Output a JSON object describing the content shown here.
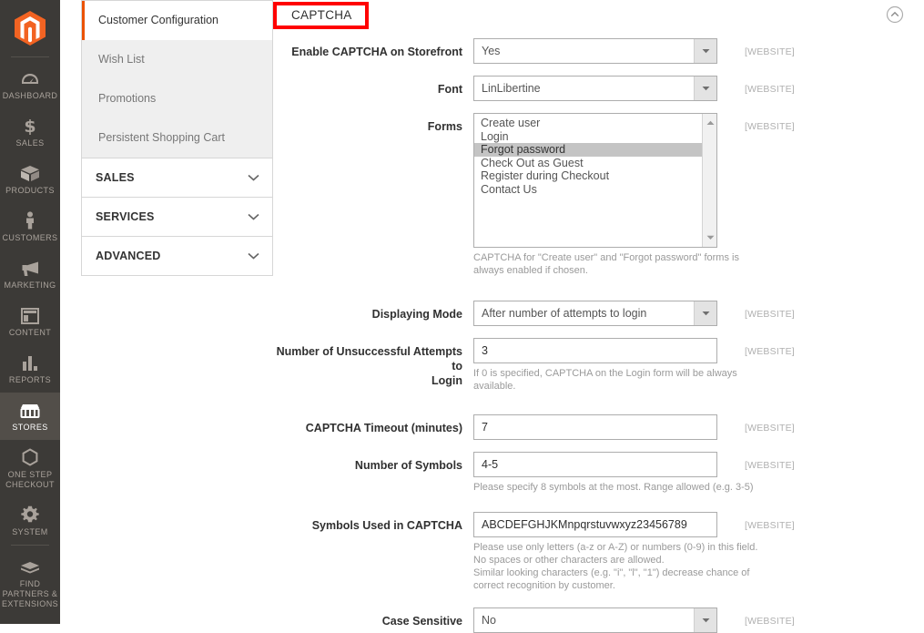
{
  "admin_rail": {
    "logo_name": "magento-logo",
    "items": [
      {
        "label": "DASHBOARD",
        "icon": "dashboard-icon",
        "active": false
      },
      {
        "label": "SALES",
        "icon": "dollar-icon",
        "active": false
      },
      {
        "label": "PRODUCTS",
        "icon": "box-icon",
        "active": false
      },
      {
        "label": "CUSTOMERS",
        "icon": "person-icon",
        "active": false
      },
      {
        "label": "MARKETING",
        "icon": "megaphone-icon",
        "active": false
      },
      {
        "label": "CONTENT",
        "icon": "layout-icon",
        "active": false
      },
      {
        "label": "REPORTS",
        "icon": "bar-chart-icon",
        "active": false
      },
      {
        "label": "STORES",
        "icon": "storefront-icon",
        "active": true
      },
      {
        "label": "ONE STEP CHECKOUT",
        "icon": "hexagon-icon",
        "active": false
      },
      {
        "label": "SYSTEM",
        "icon": "gear-icon",
        "active": false
      },
      {
        "label": "FIND PARTNERS & EXTENSIONS",
        "icon": "partners-icon",
        "active": false
      }
    ]
  },
  "config_nav": {
    "links": [
      {
        "label": "Customer Configuration",
        "active": true
      },
      {
        "label": "Wish List",
        "active": false
      },
      {
        "label": "Promotions",
        "active": false
      },
      {
        "label": "Persistent Shopping Cart",
        "active": false
      }
    ],
    "sections": [
      {
        "label": "SALES"
      },
      {
        "label": "SERVICES"
      },
      {
        "label": "ADVANCED"
      }
    ]
  },
  "section": {
    "title": "CAPTCHA",
    "collapse_icon": "chevron-up-circle-icon",
    "highlight_color": "#ff0000"
  },
  "scope_label": "[WEBSITE]",
  "fields": {
    "enable": {
      "label": "Enable CAPTCHA on Storefront",
      "value": "Yes",
      "scope": "[WEBSITE]"
    },
    "font": {
      "label": "Font",
      "value": "LinLibertine",
      "scope": "[WEBSITE]"
    },
    "forms": {
      "label": "Forms",
      "scope": "[WEBSITE]",
      "options": [
        {
          "label": "Create user",
          "selected": false
        },
        {
          "label": "Login",
          "selected": false
        },
        {
          "label": "Forgot password",
          "selected": true
        },
        {
          "label": "Check Out as Guest",
          "selected": false
        },
        {
          "label": "Register during Checkout",
          "selected": false
        },
        {
          "label": "Contact Us",
          "selected": false
        }
      ],
      "note_line1": "CAPTCHA for \"Create user\" and \"Forgot password\" forms is",
      "note_line2": "always enabled if chosen."
    },
    "displaying_mode": {
      "label": "Displaying Mode",
      "value": "After number of attempts to login",
      "scope": "[WEBSITE]"
    },
    "attempts": {
      "label_line1": "Number of Unsuccessful Attempts to",
      "label_line2": "Login",
      "value": "3",
      "scope": "[WEBSITE]",
      "note_line1": "If 0 is specified, CAPTCHA on the Login form will be always",
      "note_line2": "available."
    },
    "timeout": {
      "label": "CAPTCHA Timeout (minutes)",
      "value": "7",
      "scope": "[WEBSITE]"
    },
    "symbols_count": {
      "label": "Number of Symbols",
      "value": "4-5",
      "scope": "[WEBSITE]",
      "note_line1": "Please specify 8 symbols at the most. Range allowed (e.g. 3-5)"
    },
    "symbols_used": {
      "label": "Symbols Used in CAPTCHA",
      "value": "ABCDEFGHJKMnpqrstuvwxyz23456789",
      "scope": "[WEBSITE]",
      "note_line1": "Please use only letters (a-z or A-Z) or numbers (0-9) in this field.",
      "note_line2": "No spaces or other characters are allowed.",
      "note_line3": "Similar looking characters (e.g. \"i\", \"l\", \"1\") decrease chance of",
      "note_line4": "correct recognition by customer."
    },
    "case_sensitive": {
      "label": "Case Sensitive",
      "value": "No",
      "scope": "[WEBSITE]"
    }
  }
}
